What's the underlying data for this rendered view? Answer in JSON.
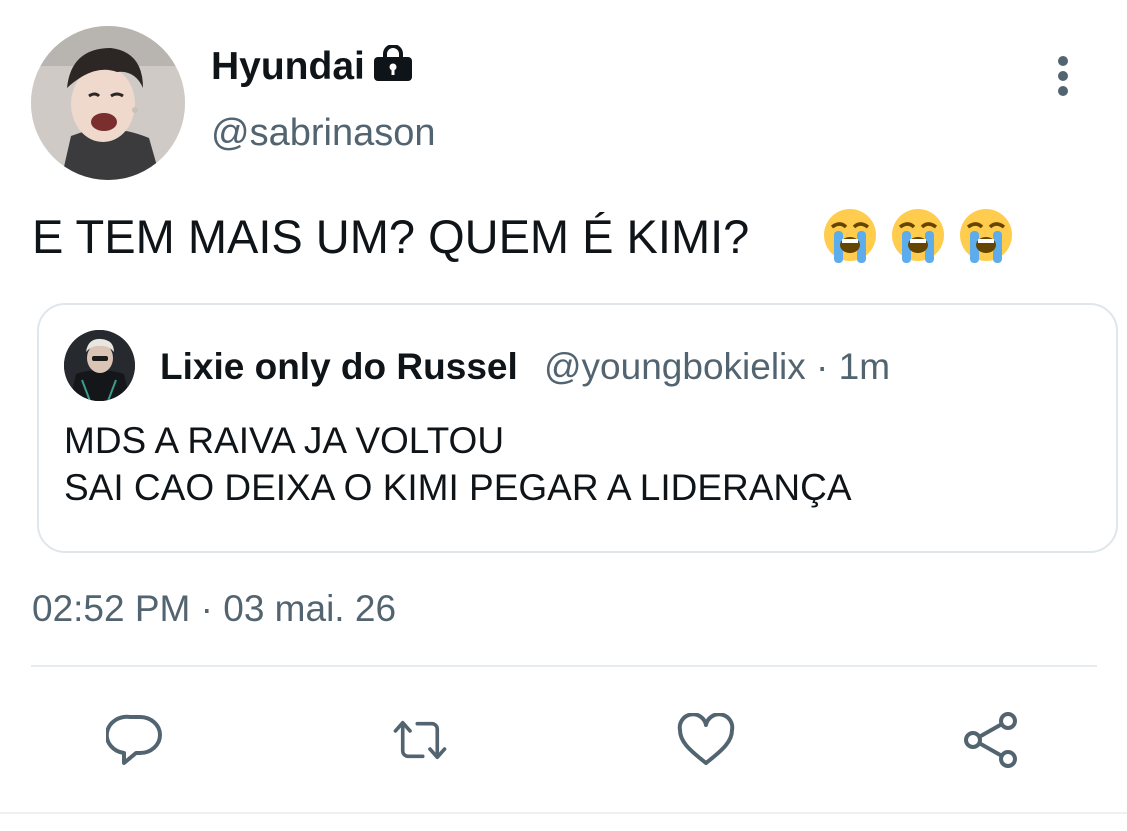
{
  "tweet": {
    "author": {
      "display_name": "Hyundai",
      "handle": "@sabrinason",
      "protected_icon": "lock-icon"
    },
    "text": "E TEM MAIS UM? QUEM É KIMI?",
    "emojis": [
      "loudly-crying-face",
      "loudly-crying-face",
      "loudly-crying-face"
    ],
    "quoted": {
      "display_name": "Lixie only do Russel",
      "meta": "@youngbokielix · 1m",
      "lines": [
        "MDS A RAIVA JA VOLTOU",
        "SAI CAO DEIXA O KIMI PEGAR A LIDERANÇA"
      ]
    },
    "timestamp": "02:52 PM · 03 mai. 26",
    "actions": [
      "reply-icon",
      "retweet-icon",
      "like-icon",
      "share-icon"
    ]
  },
  "colors": {
    "text_primary": "#0f1419",
    "text_secondary": "#536471",
    "border": "#e0e6ea",
    "icon": "#536471"
  }
}
